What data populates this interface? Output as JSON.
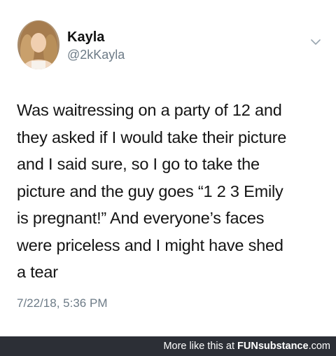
{
  "tweet": {
    "author_name": "Kayla",
    "author_handle": "@2kKayla",
    "text_lines": [
      "Was waitressing on a party of 12 and",
      "they asked if I would take their picture",
      "and I said sure, so I go to take the",
      "picture and the guy goes “1 2 3 Emily",
      "is pregnant!” And everyone’s faces",
      "were priceless and I might have shed",
      "a tear"
    ],
    "timestamp": "7/22/18, 5:36 PM"
  },
  "footer": {
    "prefix": "More like this at ",
    "brand_fun": "FUN",
    "brand_sub": "substance",
    "brand_tld": ".com"
  },
  "icons": {
    "menu": "chevron-down-icon",
    "avatar": "avatar"
  },
  "colors": {
    "text": "#141414",
    "secondary": "#6d7b87",
    "footer_bg": "#2c2f36"
  }
}
